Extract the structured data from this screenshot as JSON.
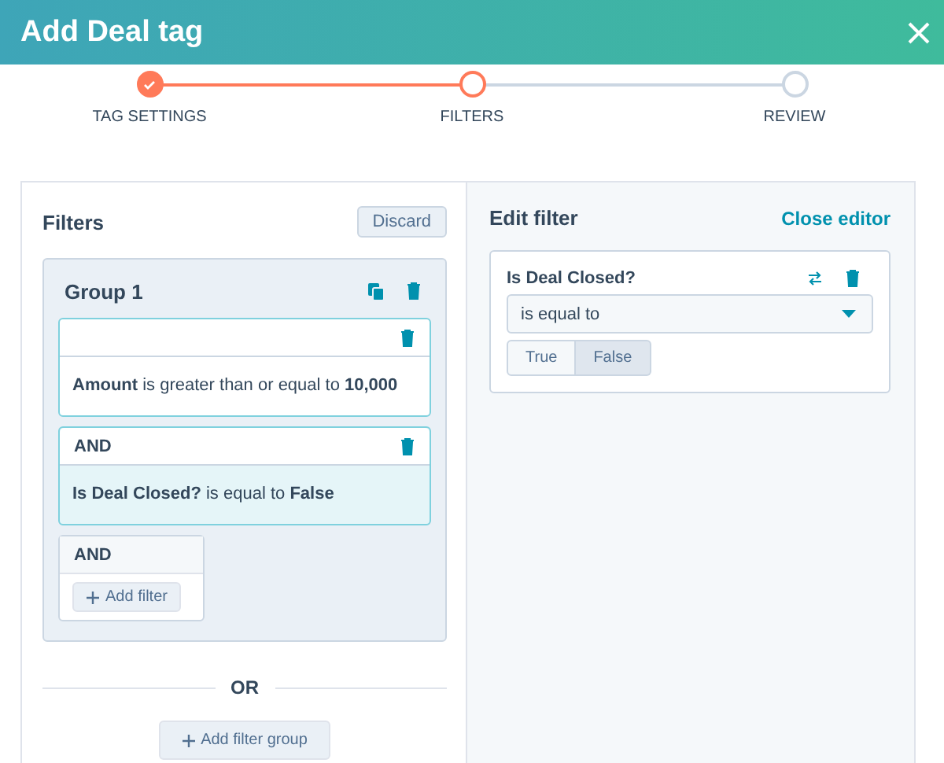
{
  "window": {
    "title": "Add Deal tag"
  },
  "steps": [
    {
      "label": "TAG SETTINGS",
      "completed": true,
      "selected": false
    },
    {
      "label": "FILTERS",
      "completed": false,
      "selected": true
    },
    {
      "label": "REVIEW",
      "completed": false,
      "selected": false
    }
  ],
  "filters_panel": {
    "title": "Filters",
    "discard": "Discard",
    "groups": [
      {
        "title": "Group 1",
        "filters": [
          {
            "text": "**Amount** is greater than or equal to **10,000**",
            "selected": false
          },
          {
            "connector": "AND",
            "text": "**Is Deal Closed?** is equal to **False**",
            "selected": true
          }
        ],
        "add_connector": "AND",
        "add_filter": "Add filter"
      }
    ],
    "or_label": "OR",
    "add_group": "Add filter group"
  },
  "editor": {
    "title": "Edit filter",
    "close": "Close editor",
    "property": "Is Deal Closed?",
    "operator": "is equal to",
    "options": [
      {
        "label": "True",
        "selected": false
      },
      {
        "label": "False",
        "selected": true
      }
    ]
  }
}
